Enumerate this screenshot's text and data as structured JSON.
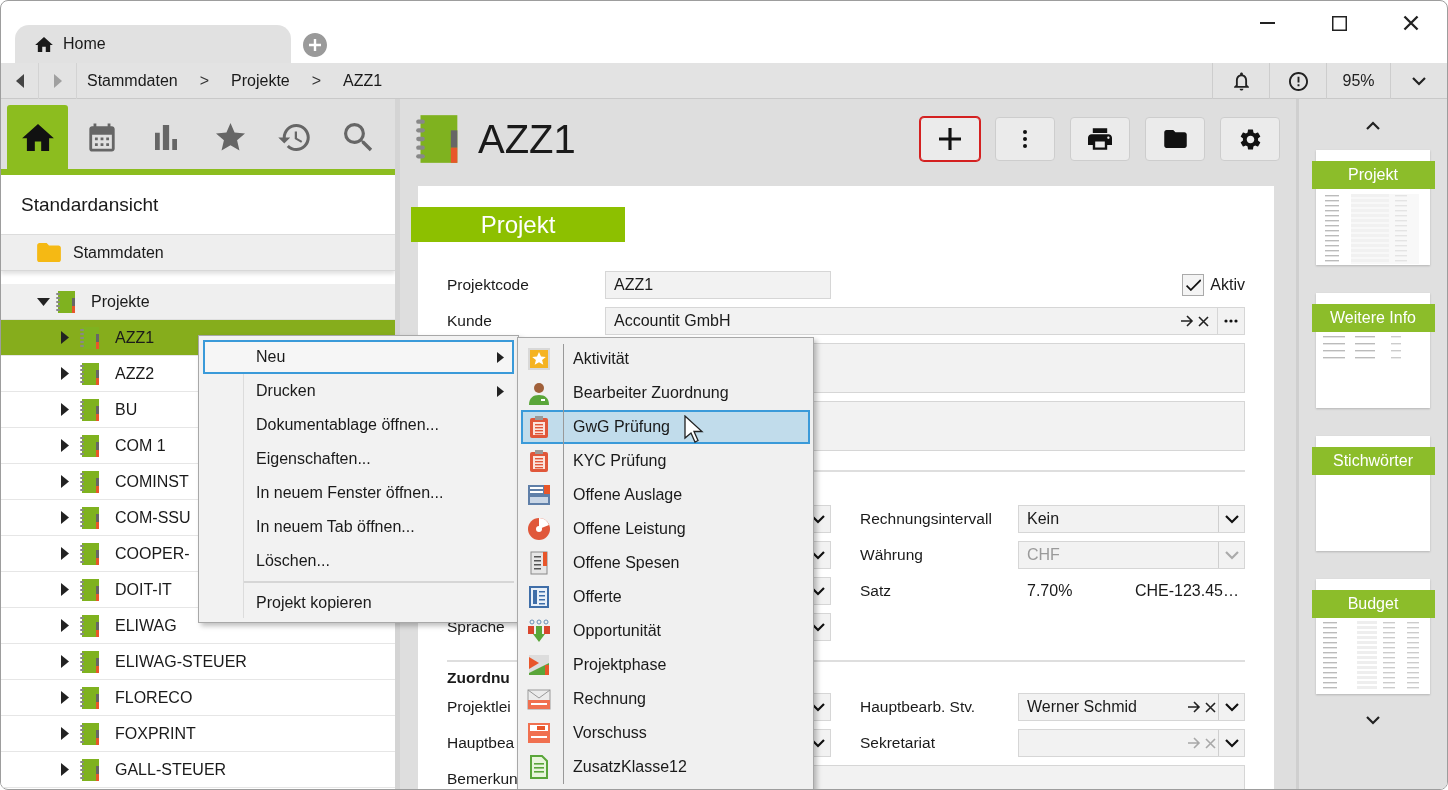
{
  "window": {
    "tab": "Home"
  },
  "nav": {
    "history": [
      {
        "kind": "back",
        "disabled": false
      },
      {
        "kind": "forward",
        "disabled": true
      }
    ],
    "breadcrumb": [
      {
        "label": "Stammdaten",
        "separator": ">"
      },
      {
        "label": "Projekte",
        "separator": ">"
      },
      {
        "label": "AZZ1"
      }
    ],
    "zoom": "95%"
  },
  "sidebar": {
    "tabs": [
      {
        "kind": "home",
        "selected": true
      },
      {
        "kind": "calendar",
        "selected": false
      },
      {
        "kind": "stats",
        "selected": false
      },
      {
        "kind": "favorites",
        "selected": false
      },
      {
        "kind": "history",
        "selected": false
      },
      {
        "kind": "search",
        "selected": false
      }
    ],
    "view_title": "Standardansicht",
    "tree": [
      {
        "label": "Stammdaten",
        "kind": "folder",
        "children": [
          {
            "label": "Projekte",
            "kind": "group",
            "expanded": true,
            "children": [
              {
                "label": "AZZ1",
                "kind": "project",
                "expanded": false,
                "selected": true
              },
              {
                "label": "AZZ2",
                "kind": "project",
                "expanded": false,
                "selected": false
              },
              {
                "label": "BU",
                "kind": "project",
                "expanded": false,
                "selected": false
              },
              {
                "label": "COM 1",
                "kind": "project",
                "expanded": false,
                "selected": false
              },
              {
                "label": "COMINST",
                "kind": "project",
                "expanded": false,
                "selected": false
              },
              {
                "label": "COM-SSU",
                "kind": "project",
                "expanded": false,
                "selected": false
              },
              {
                "label": "COOPER-",
                "kind": "project",
                "expanded": false,
                "selected": false
              },
              {
                "label": "DOIT-IT",
                "kind": "project",
                "expanded": false,
                "selected": false
              },
              {
                "label": "ELIWAG",
                "kind": "project",
                "expanded": false,
                "selected": false
              },
              {
                "label": "ELIWAG-STEUER",
                "kind": "project",
                "expanded": false,
                "selected": false
              },
              {
                "label": "FLORECO",
                "kind": "project",
                "expanded": false,
                "selected": false
              },
              {
                "label": "FOXPRINT",
                "kind": "project",
                "expanded": false,
                "selected": false
              },
              {
                "label": "GALL-STEUER",
                "kind": "project",
                "expanded": false,
                "selected": false
              }
            ]
          }
        ]
      }
    ]
  },
  "record": {
    "title": "AZZ1",
    "toolbar": [
      {
        "kind": "add",
        "selected": true
      },
      {
        "kind": "more",
        "selected": false
      },
      {
        "kind": "print",
        "selected": false
      },
      {
        "kind": "folder",
        "selected": false
      },
      {
        "kind": "settings",
        "selected": false
      }
    ],
    "form": {
      "section": "Projekt",
      "rows": [
        {
          "kind": "split",
          "left": {
            "kind": "text",
            "label": "Projektcode",
            "value": "AZZ1"
          },
          "right": {
            "kind": "checkbox",
            "label": "Aktiv",
            "checked": true
          }
        },
        {
          "kind": "wide",
          "field": {
            "kind": "lookup_more",
            "label": "Kunde",
            "value": "Accountit GmbH"
          }
        },
        {
          "kind": "wide",
          "field": {
            "kind": "textarea"
          }
        },
        {
          "kind": "wide",
          "field": {
            "kind": "textarea"
          }
        },
        {
          "kind": "divider"
        },
        {
          "kind": "split",
          "left": {
            "kind": "select",
            "disabled": false
          },
          "right": {
            "kind": "select",
            "label": "Rechnungsintervall",
            "value": "Kein",
            "disabled": false
          }
        },
        {
          "kind": "split",
          "left": {
            "kind": "select",
            "disabled": false
          },
          "right": {
            "kind": "select",
            "label": "Währung",
            "value": "CHF",
            "disabled": true
          }
        },
        {
          "kind": "split",
          "left": {
            "kind": "select",
            "disabled": false
          },
          "right": {
            "kind": "readonly",
            "label": "Satz",
            "value": "7.70%",
            "extra": "CHE-123.45…"
          }
        },
        {
          "kind": "split",
          "left": {
            "kind": "select",
            "label": "Sprache",
            "disabled": false
          }
        },
        {
          "kind": "divider"
        },
        {
          "kind": "heading",
          "text": "Zuordnu"
        },
        {
          "kind": "split",
          "left": {
            "kind": "select",
            "label": "Projektlei",
            "disabled": false
          },
          "right": {
            "kind": "lookup_select",
            "label": "Hauptbearb. Stv.",
            "value": "Werner Schmid",
            "disabled": false
          }
        },
        {
          "kind": "split",
          "left": {
            "kind": "select",
            "label": "Hauptbea",
            "disabled": false
          },
          "right": {
            "kind": "lookup_select",
            "label": "Sekretariat",
            "disabled": true
          }
        },
        {
          "kind": "wide",
          "field": {
            "kind": "textarea",
            "label": "Bemerkun"
          }
        }
      ]
    }
  },
  "pages": [
    {
      "title": "Projekt",
      "kind": "form"
    },
    {
      "title": "Weitere Info",
      "kind": "info"
    },
    {
      "title": "Stichwörter",
      "kind": "blank"
    },
    {
      "title": "Budget",
      "kind": "table"
    }
  ],
  "context_menu": {
    "groups": [
      [
        {
          "label": "Neu",
          "submenu": true,
          "selected": true
        },
        {
          "label": "Drucken",
          "submenu": true,
          "selected": false
        },
        {
          "label": "Dokumentablage öffnen...",
          "submenu": false,
          "selected": false
        },
        {
          "label": "Eigenschaften...",
          "submenu": false,
          "selected": false
        },
        {
          "label": "In neuem Fenster öffnen...",
          "submenu": false,
          "selected": false
        },
        {
          "label": "In neuem Tab öffnen...",
          "submenu": false,
          "selected": false
        },
        {
          "label": "Löschen...",
          "submenu": false,
          "selected": false
        }
      ],
      [
        {
          "label": "Projekt kopieren",
          "submenu": false,
          "selected": false
        }
      ]
    ]
  },
  "submenu": {
    "items": [
      {
        "label": "Aktivität",
        "kind": "activity",
        "selected": false
      },
      {
        "label": "Bearbeiter Zuordnung",
        "kind": "assignment",
        "selected": false
      },
      {
        "label": "GwG Prüfung",
        "kind": "check",
        "selected": true
      },
      {
        "label": "KYC Prüfung",
        "kind": "check",
        "selected": false
      },
      {
        "label": "Offene Auslage",
        "kind": "expense",
        "selected": false
      },
      {
        "label": "Offene Leistung",
        "kind": "service",
        "selected": false
      },
      {
        "label": "Offene Spesen",
        "kind": "spesen",
        "selected": false
      },
      {
        "label": "Offerte",
        "kind": "offer",
        "selected": false
      },
      {
        "label": "Opportunität",
        "kind": "opportunity",
        "selected": false
      },
      {
        "label": "Projektphase",
        "kind": "phase",
        "selected": false
      },
      {
        "label": "Rechnung",
        "kind": "invoice",
        "selected": false
      },
      {
        "label": "Vorschuss",
        "kind": "advance",
        "selected": false
      },
      {
        "label": "ZusatzKlasse12",
        "kind": "custom",
        "selected": false
      }
    ]
  }
}
